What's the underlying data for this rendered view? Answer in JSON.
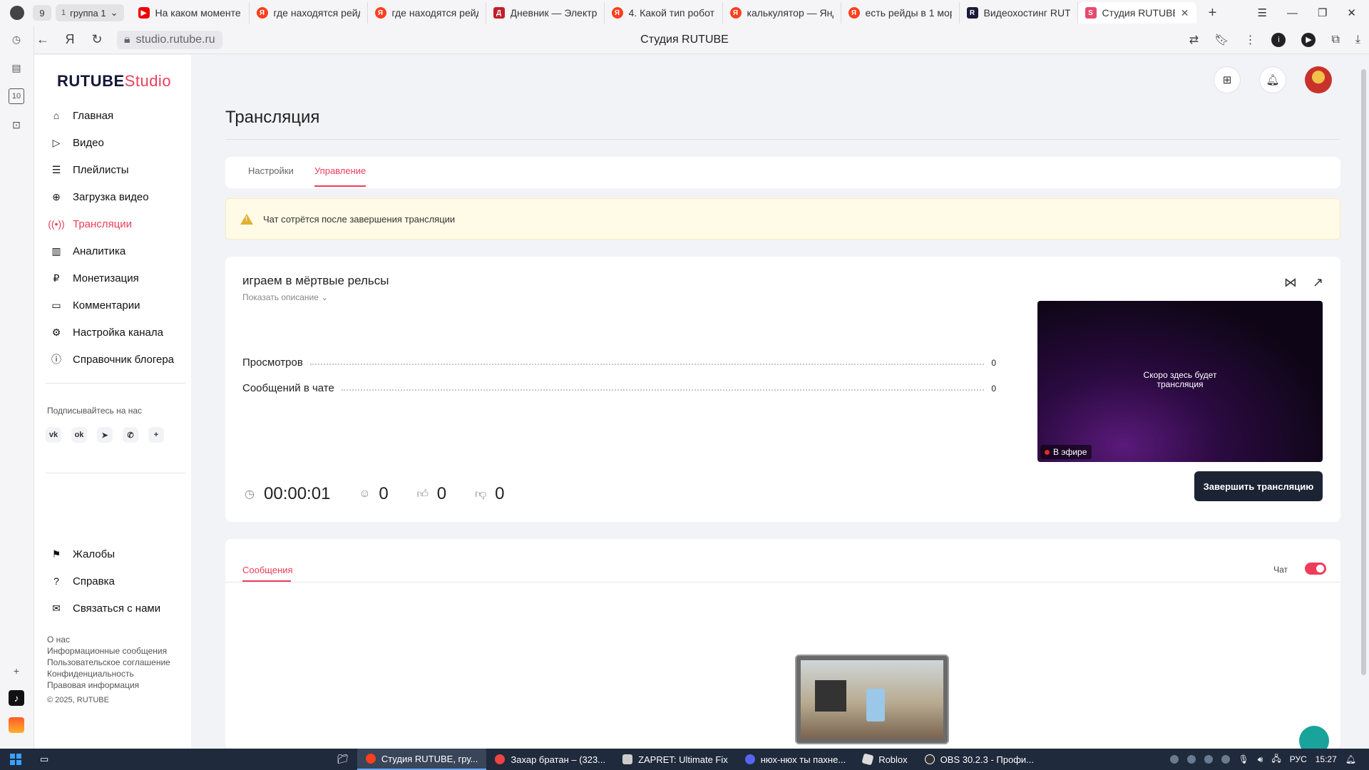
{
  "browser": {
    "tab_count": "9",
    "group": {
      "number": "1",
      "name": "группа 1"
    },
    "tabs": [
      {
        "label": "На каком моменте",
        "favicon": "youtube-icon"
      },
      {
        "label": "где находятся рейд",
        "favicon": "yandex-icon"
      },
      {
        "label": "где находятся рейд",
        "favicon": "yandex-icon"
      },
      {
        "label": "Дневник — Электр",
        "favicon": "diary-icon"
      },
      {
        "label": "4. Какой тип робот",
        "favicon": "yandex-icon"
      },
      {
        "label": "калькулятор — Янд",
        "favicon": "yandex-icon"
      },
      {
        "label": "есть рейды в 1 мор",
        "favicon": "yandex-icon"
      },
      {
        "label": "Видеохостинг RUT",
        "favicon": "rutube-icon"
      },
      {
        "label": "Студия RUTUBE",
        "favicon": "studio-icon",
        "active": true
      }
    ],
    "url": "studio.rutube.ru",
    "page_title": "Студия RUTUBE"
  },
  "studio": {
    "brand": {
      "main": "RUTUBE",
      "suffix": "Studio"
    },
    "menu": [
      {
        "label": "Главная",
        "icon": "home-icon"
      },
      {
        "label": "Видео",
        "icon": "video-icon"
      },
      {
        "label": "Плейлисты",
        "icon": "playlist-icon"
      },
      {
        "label": "Загрузка видео",
        "icon": "upload-icon"
      },
      {
        "label": "Трансляции",
        "icon": "broadcast-icon",
        "active": true
      },
      {
        "label": "Аналитика",
        "icon": "analytics-icon"
      },
      {
        "label": "Монетизация",
        "icon": "monetization-icon"
      },
      {
        "label": "Комментарии",
        "icon": "comments-icon"
      },
      {
        "label": "Настройка канала",
        "icon": "gear-icon"
      },
      {
        "label": "Справочник блогера",
        "icon": "info-icon"
      }
    ],
    "subscribe_label": "Подписывайтесь на нас",
    "socials": [
      "vk-icon",
      "ok-icon",
      "telegram-icon",
      "viber-icon",
      "plus-icon"
    ],
    "menu2": [
      {
        "label": "Жалобы",
        "icon": "flag-icon"
      },
      {
        "label": "Справка",
        "icon": "help-icon"
      },
      {
        "label": "Связаться с нами",
        "icon": "mail-icon"
      }
    ],
    "footer_links": [
      "О нас",
      "Информационные сообщения",
      "Пользовательское соглашение",
      "Конфиденциальность",
      "Правовая информация"
    ],
    "copyright": "© 2025, RUTUBE",
    "page_heading": "Трансляция",
    "tabs": [
      {
        "label": "Настройки"
      },
      {
        "label": "Управление",
        "active": true
      }
    ],
    "warning": "Чат сотрётся после завершения трансляции",
    "stream": {
      "title": "играем в мёртвые рельсы",
      "show_description": "Показать описание",
      "stats": [
        {
          "label": "Просмотров",
          "value": "0"
        },
        {
          "label": "Сообщений в чате",
          "value": "0"
        }
      ],
      "duration": "00:00:01",
      "viewers": "0",
      "likes": "0",
      "dislikes": "0",
      "preview_text_line1": "Скоро здесь будет",
      "preview_text_line2": "трансляция",
      "live_badge": "В эфире",
      "end_button": "Завершить трансляцию"
    },
    "chat": {
      "tab_label": "Сообщения",
      "toggle_label": "Чат",
      "toggle_on": true
    }
  },
  "taskbar": {
    "tasks": [
      {
        "label": "Студия RUTUBE, гру...",
        "active": true
      },
      {
        "label": "Захар братан – (323..."
      },
      {
        "label": "ZAPRET: Ultimate Fix"
      },
      {
        "label": "нюх-нюх ты пахне..."
      },
      {
        "label": "Roblox"
      },
      {
        "label": "OBS 30.2.3 - Профи..."
      }
    ],
    "lang": "РУС",
    "time": "15:27"
  },
  "colors": {
    "accent": "#ee3d5a",
    "dark_button": "#1c2333",
    "warning_bg": "#fffbe6",
    "taskbar": "#1f2a3c"
  }
}
